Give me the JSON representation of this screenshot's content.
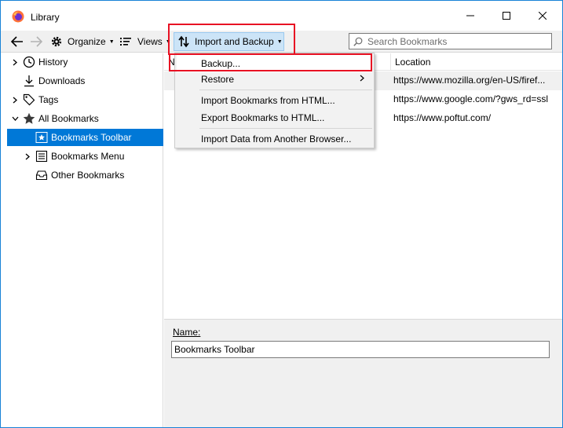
{
  "window": {
    "title": "Library"
  },
  "toolbar": {
    "organize_label": "Organize",
    "views_label": "Views",
    "import_backup_label": "Import and Backup",
    "search_placeholder": "Search Bookmarks"
  },
  "sidebar": {
    "items": [
      {
        "label": "History",
        "icon": "clock-icon"
      },
      {
        "label": "Downloads",
        "icon": "download-icon"
      },
      {
        "label": "Tags",
        "icon": "tag-icon"
      },
      {
        "label": "All Bookmarks",
        "icon": "star-icon"
      },
      {
        "label": "Bookmarks Toolbar",
        "icon": "bookmarks-toolbar-icon"
      },
      {
        "label": "Bookmarks Menu",
        "icon": "bookmarks-menu-icon"
      },
      {
        "label": "Other Bookmarks",
        "icon": "other-bookmarks-icon"
      }
    ]
  },
  "table": {
    "columns": [
      "N",
      "Location"
    ],
    "rows": [
      {
        "location": "https://www.mozilla.org/en-US/firef..."
      },
      {
        "location": "https://www.google.com/?gws_rd=ssl"
      },
      {
        "location": "https://www.poftut.com/"
      }
    ]
  },
  "menu": {
    "items": [
      {
        "label": "Backup..."
      },
      {
        "label": "Restore"
      },
      {
        "label": "Import Bookmarks from HTML..."
      },
      {
        "label": "Export Bookmarks to HTML..."
      },
      {
        "label": "Import Data from Another Browser..."
      }
    ]
  },
  "details": {
    "name_label": "Name:",
    "name_value": "Bookmarks Toolbar"
  },
  "colors": {
    "selection": "#0078d7",
    "highlight": "#e81123",
    "button_hover": "#cce4f7"
  }
}
